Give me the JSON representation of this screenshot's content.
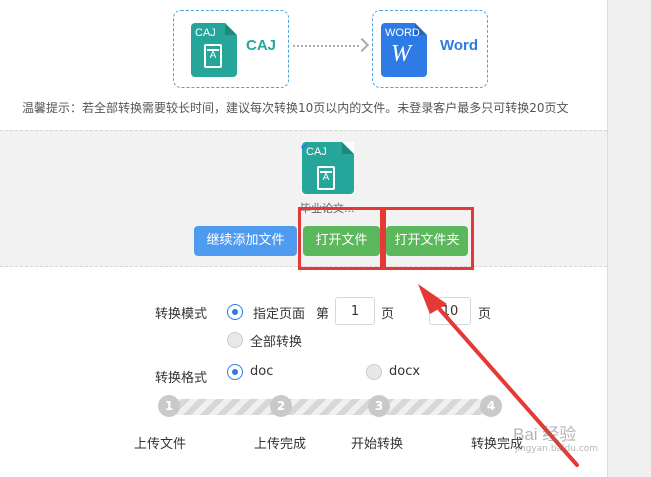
{
  "conversion": {
    "from": {
      "tag": "CAJ",
      "label": "CAJ"
    },
    "to": {
      "tag": "WORD",
      "label": "Word",
      "glyph": "W"
    }
  },
  "tip": "温馨提示：若全部转换需要较长时间，建议每次转换10页以内的文件。未登录客户最多只可转换20页文",
  "file": {
    "tag": "CAJ",
    "glyph": "A",
    "name": "毕业论文..."
  },
  "buttons": {
    "add": "继续添加文件",
    "open_file": "打开文件",
    "open_folder": "打开文件夹"
  },
  "options": {
    "mode_label": "转换模式",
    "mode_selected": "指定页面",
    "mode_all": "全部转换",
    "page_prefix": "第",
    "page_from": "1",
    "page_mid": "页",
    "page_to": "10",
    "page_suffix": "页",
    "format_label": "转换格式",
    "format_doc": "doc",
    "format_docx": "docx"
  },
  "steps": [
    {
      "num": "1",
      "label": "上传文件"
    },
    {
      "num": "2",
      "label": "上传完成"
    },
    {
      "num": "3",
      "label": "开始转换"
    },
    {
      "num": "4",
      "label": "转换完成"
    }
  ],
  "watermark": {
    "text": "Bai 经验",
    "sub": "jingyan.baidu.com"
  },
  "colors": {
    "caj": "#26a69a",
    "word": "#2f7be6",
    "green": "#5cb85c",
    "blue": "#4e9bf0",
    "annotation": "#e53935"
  }
}
